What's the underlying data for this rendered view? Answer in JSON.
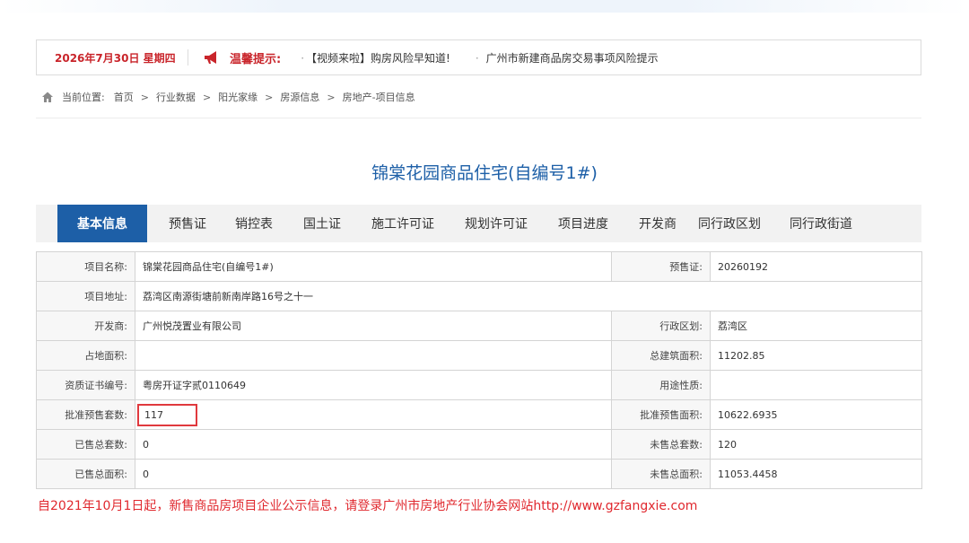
{
  "notice": {
    "date": "2026年7月30日 星期四",
    "label": "温馨提示:",
    "items": [
      "【视频来啦】购房风险早知道!",
      "广州市新建商品房交易事项风险提示"
    ]
  },
  "breadcrumb": {
    "prefix": "当前位置:",
    "items": [
      "首页",
      "行业数据",
      "阳光家缘",
      "房源信息",
      "房地产-项目信息"
    ],
    "separator": ">"
  },
  "project": {
    "title": "锦棠花园商品住宅(自编号1#)"
  },
  "tabs": [
    "基本信息",
    "预售证",
    "销控表",
    "国土证",
    "施工许可证",
    "规划许可证",
    "项目进度",
    "开发商",
    "同行政区划",
    "同行政街道"
  ],
  "info": {
    "project_name_label": "项目名称:",
    "project_name": "锦棠花园商品住宅(自编号1#)",
    "presale_cert_label": "预售证:",
    "presale_cert": "20260192",
    "address_label": "项目地址:",
    "address": "荔湾区南源街塘前新南岸路16号之十一",
    "developer_label": "开发商:",
    "developer": "广州悦茂置业有限公司",
    "district_label": "行政区划:",
    "district": "荔湾区",
    "land_area_label": "占地面积:",
    "land_area": "",
    "total_building_area_label": "总建筑面积:",
    "total_building_area": "11202.85",
    "qualification_label": "资质证书编号:",
    "qualification": "粤房开证字贰0110649",
    "usage_label": "用途性质:",
    "usage": "",
    "approved_units_label": "批准预售套数:",
    "approved_units": "117",
    "approved_area_label": "批准预售面积:",
    "approved_area": "10622.6935",
    "sold_units_label": "已售总套数:",
    "sold_units": "0",
    "unsold_units_label": "未售总套数:",
    "unsold_units": "120",
    "sold_area_label": "已售总面积:",
    "sold_area": "0",
    "unsold_area_label": "未售总面积:",
    "unsold_area": "11053.4458"
  },
  "footer": {
    "note": "自2021年10月1日起，新售商品房项目企业公示信息，请登录广州市房地产行业协会网站http://www.gzfangxie.com"
  },
  "colors": {
    "accent_blue": "#1d5fa7",
    "alert_red": "#c9252b",
    "highlight_red": "#e0393e"
  },
  "icons": {
    "horn": "megaphone-icon",
    "home": "home-icon"
  }
}
